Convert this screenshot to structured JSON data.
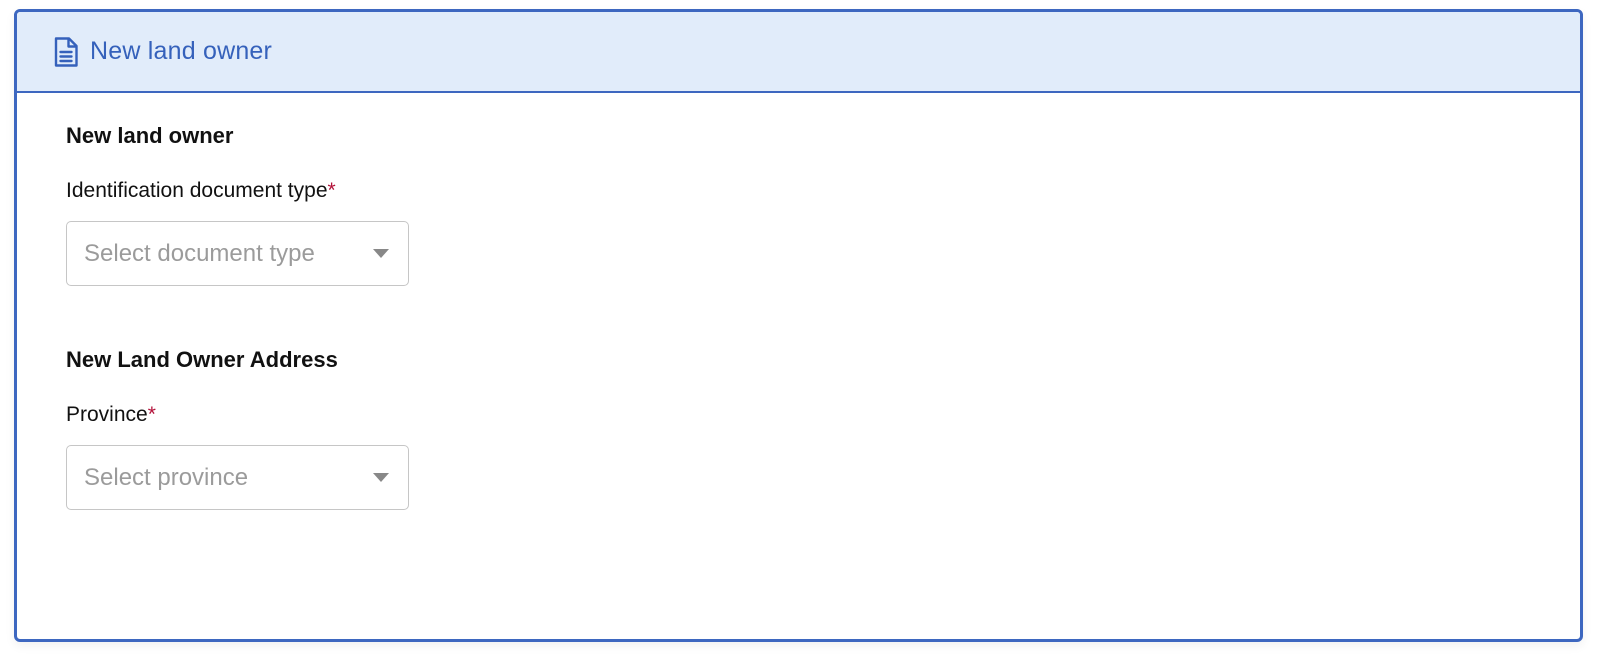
{
  "header": {
    "title": "New land owner",
    "icon": "document-icon",
    "accent_color": "#3d67c0",
    "background_color": "#e1ecfa"
  },
  "owner_section": {
    "title": "New land owner",
    "document_type": {
      "label": "Identification document type",
      "required_mark": "*",
      "placeholder": "Select document type"
    }
  },
  "address_section": {
    "title": "New Land Owner Address",
    "province": {
      "label": "Province",
      "required_mark": "*",
      "placeholder": "Select province"
    }
  }
}
